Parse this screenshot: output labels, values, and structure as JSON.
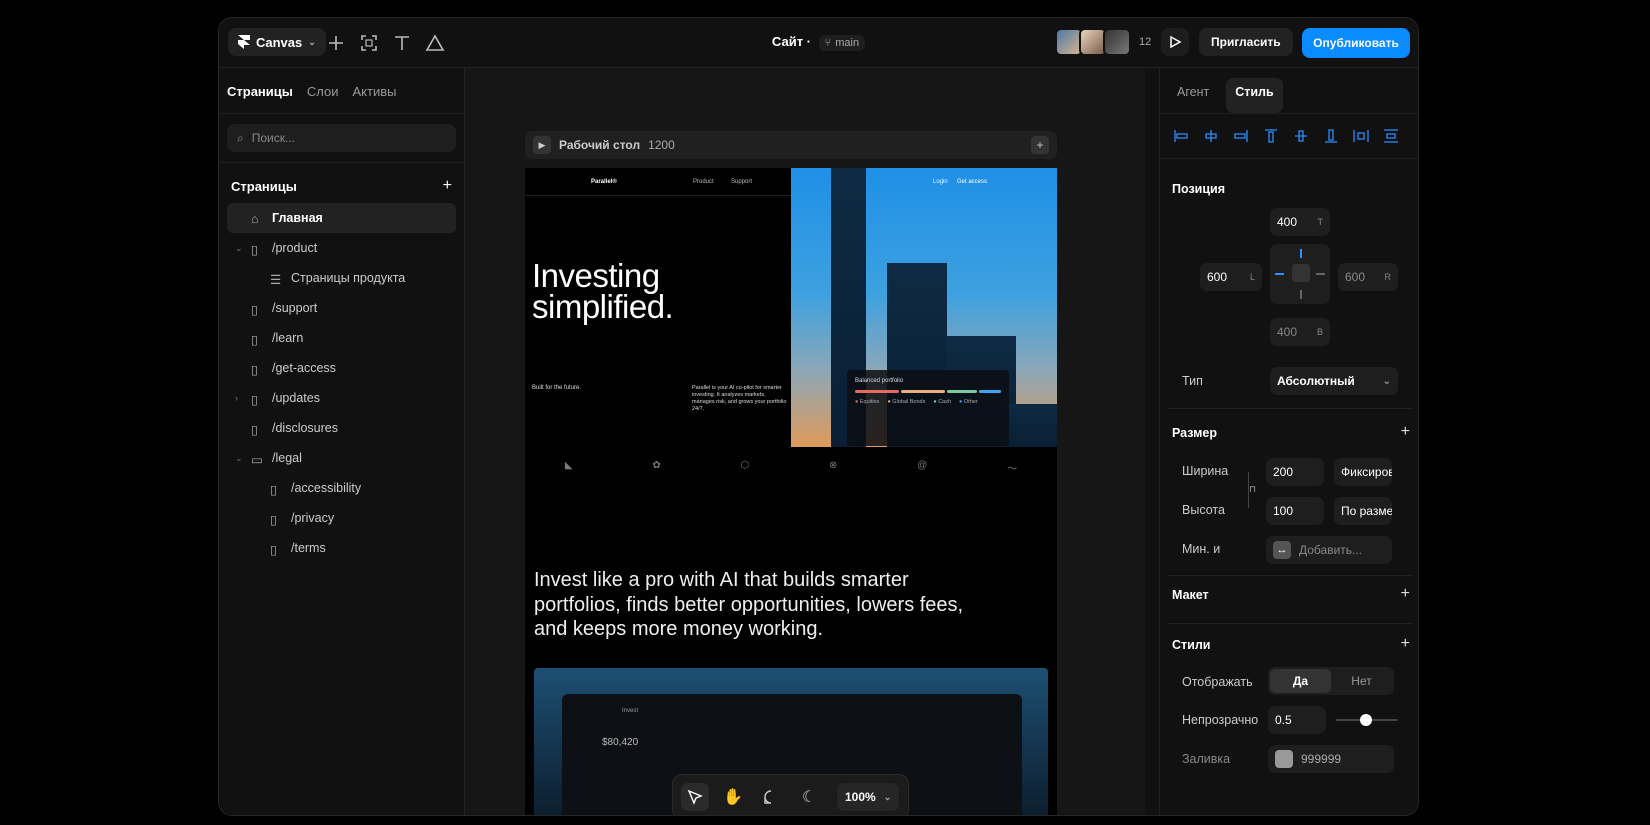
{
  "topbar": {
    "brand": "Canvas",
    "site_title": "Сайт",
    "branch": "main",
    "collab_count": "12",
    "invite": "Пригласить",
    "publish": "Опубликовать"
  },
  "left": {
    "tabs": [
      "Страницы",
      "Слои",
      "Активы"
    ],
    "search_placeholder": "Поиск...",
    "section": "Страницы",
    "pages": [
      {
        "label": "Главная",
        "icon": "home-icon"
      },
      {
        "label": "/product",
        "icon": "page-icon"
      },
      {
        "label": "Страницы продукта",
        "icon": "database-icon"
      },
      {
        "label": "/support",
        "icon": "page-icon"
      },
      {
        "label": "/learn",
        "icon": "page-icon"
      },
      {
        "label": "/get-access",
        "icon": "page-icon"
      },
      {
        "label": "/updates",
        "icon": "page-icon"
      },
      {
        "label": "/disclosures",
        "icon": "page-icon"
      },
      {
        "label": "/legal",
        "icon": "folder-icon"
      },
      {
        "label": "/accessibility",
        "icon": "page-icon"
      },
      {
        "label": "/privacy",
        "icon": "page-icon"
      },
      {
        "label": "/terms",
        "icon": "page-icon"
      }
    ]
  },
  "canvas": {
    "frame_name": "Рабочий стол",
    "frame_width": "1200",
    "site": {
      "logo": "Parallel®",
      "nav_product": "Product",
      "nav_support": "Support",
      "login": "Login",
      "get_access": "Get access",
      "hero_line1": "Investing",
      "hero_line2": "simplified.",
      "built": "Built for the future.",
      "para": "Parallel is your AI co-pilot for smarter investing. It analyzes markets, manages risk, and grows your portfolio 24/7.",
      "card_title": "Balanced portfolio",
      "legend": [
        "Equities",
        "Global Bonds",
        "Cash",
        "Other"
      ],
      "headline": "Invest like a pro with AI that builds smarter portfolios, finds better opportunities, lowers fees, and keeps more money working.",
      "app_value": "$80,420",
      "app_label": "Invest"
    },
    "zoom": "100%"
  },
  "right": {
    "tabs": [
      "Агент",
      "Стиль"
    ],
    "position": {
      "title": "Позиция",
      "top": "400",
      "top_u": "T",
      "left": "600",
      "left_u": "L",
      "right": "600",
      "right_u": "R",
      "bottom": "400",
      "bottom_u": "B",
      "type_label": "Тип",
      "type_value": "Абсолютный"
    },
    "size": {
      "title": "Размер",
      "width_label": "Ширина",
      "width": "200",
      "width_mode": "Фиксирован",
      "height_label": "Высота",
      "height": "100",
      "height_mode": "По разме",
      "min_label": "Мин. и",
      "min_placeholder": "Добавить..."
    },
    "layout_title": "Макет",
    "styles": {
      "title": "Стили",
      "visible_label": "Отображать",
      "yes": "Да",
      "no": "Нет",
      "opacity_label": "Непрозрачно",
      "opacity": "0.5",
      "fill_label": "Заливка",
      "fill": "999999"
    }
  }
}
